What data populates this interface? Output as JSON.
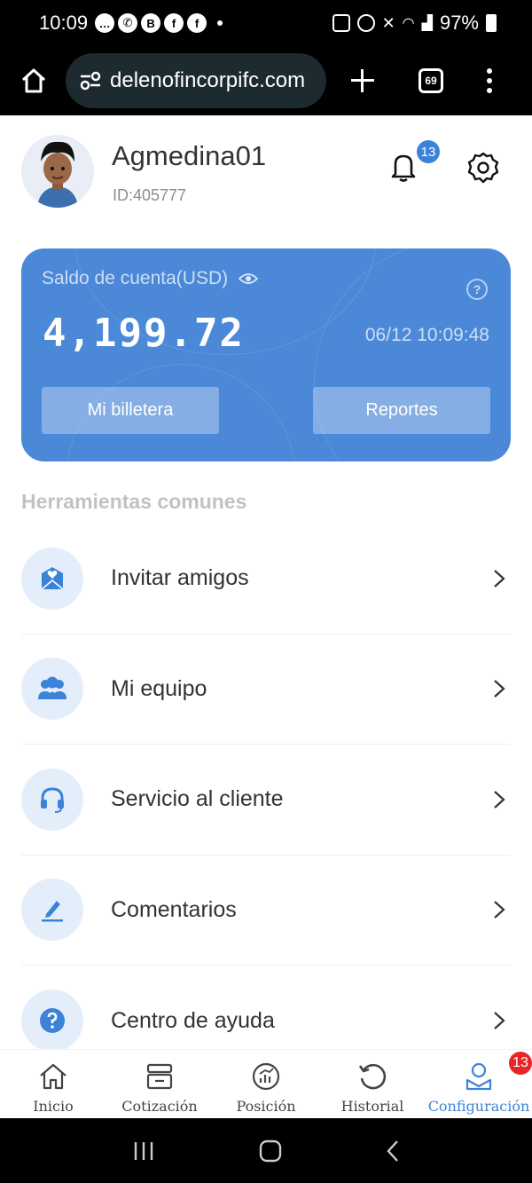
{
  "status_bar": {
    "time": "10:09",
    "battery": "97%"
  },
  "browser": {
    "url": "delenofincorpifc.com",
    "tab_count": "69"
  },
  "profile": {
    "username": "Agmedina01",
    "id": "ID:405777",
    "notification_count": "13"
  },
  "balance_card": {
    "label": "Saldo de cuenta(USD)",
    "amount": "4,199.72",
    "timestamp": "06/12 10:09:48",
    "wallet_button": "Mi billetera",
    "reports_button": "Reportes",
    "color": "#4b88d8"
  },
  "tools": {
    "title": "Herramientas comunes",
    "items": [
      {
        "label": "Invitar amigos",
        "icon": "mail-heart-icon"
      },
      {
        "label": "Mi equipo",
        "icon": "team-icon"
      },
      {
        "label": "Servicio al cliente",
        "icon": "headset-icon"
      },
      {
        "label": "Comentarios",
        "icon": "pencil-icon"
      },
      {
        "label": "Centro de ayuda",
        "icon": "question-icon"
      }
    ]
  },
  "bottom_nav": {
    "items": [
      {
        "label": "Inicio",
        "icon": "home-icon"
      },
      {
        "label": "Cotización",
        "icon": "quotes-icon"
      },
      {
        "label": "Posición",
        "icon": "position-chart-icon"
      },
      {
        "label": "Historial",
        "icon": "history-icon"
      },
      {
        "label": "Configuración",
        "icon": "profile-icon"
      }
    ],
    "active": "Configuración",
    "badge": "13"
  }
}
